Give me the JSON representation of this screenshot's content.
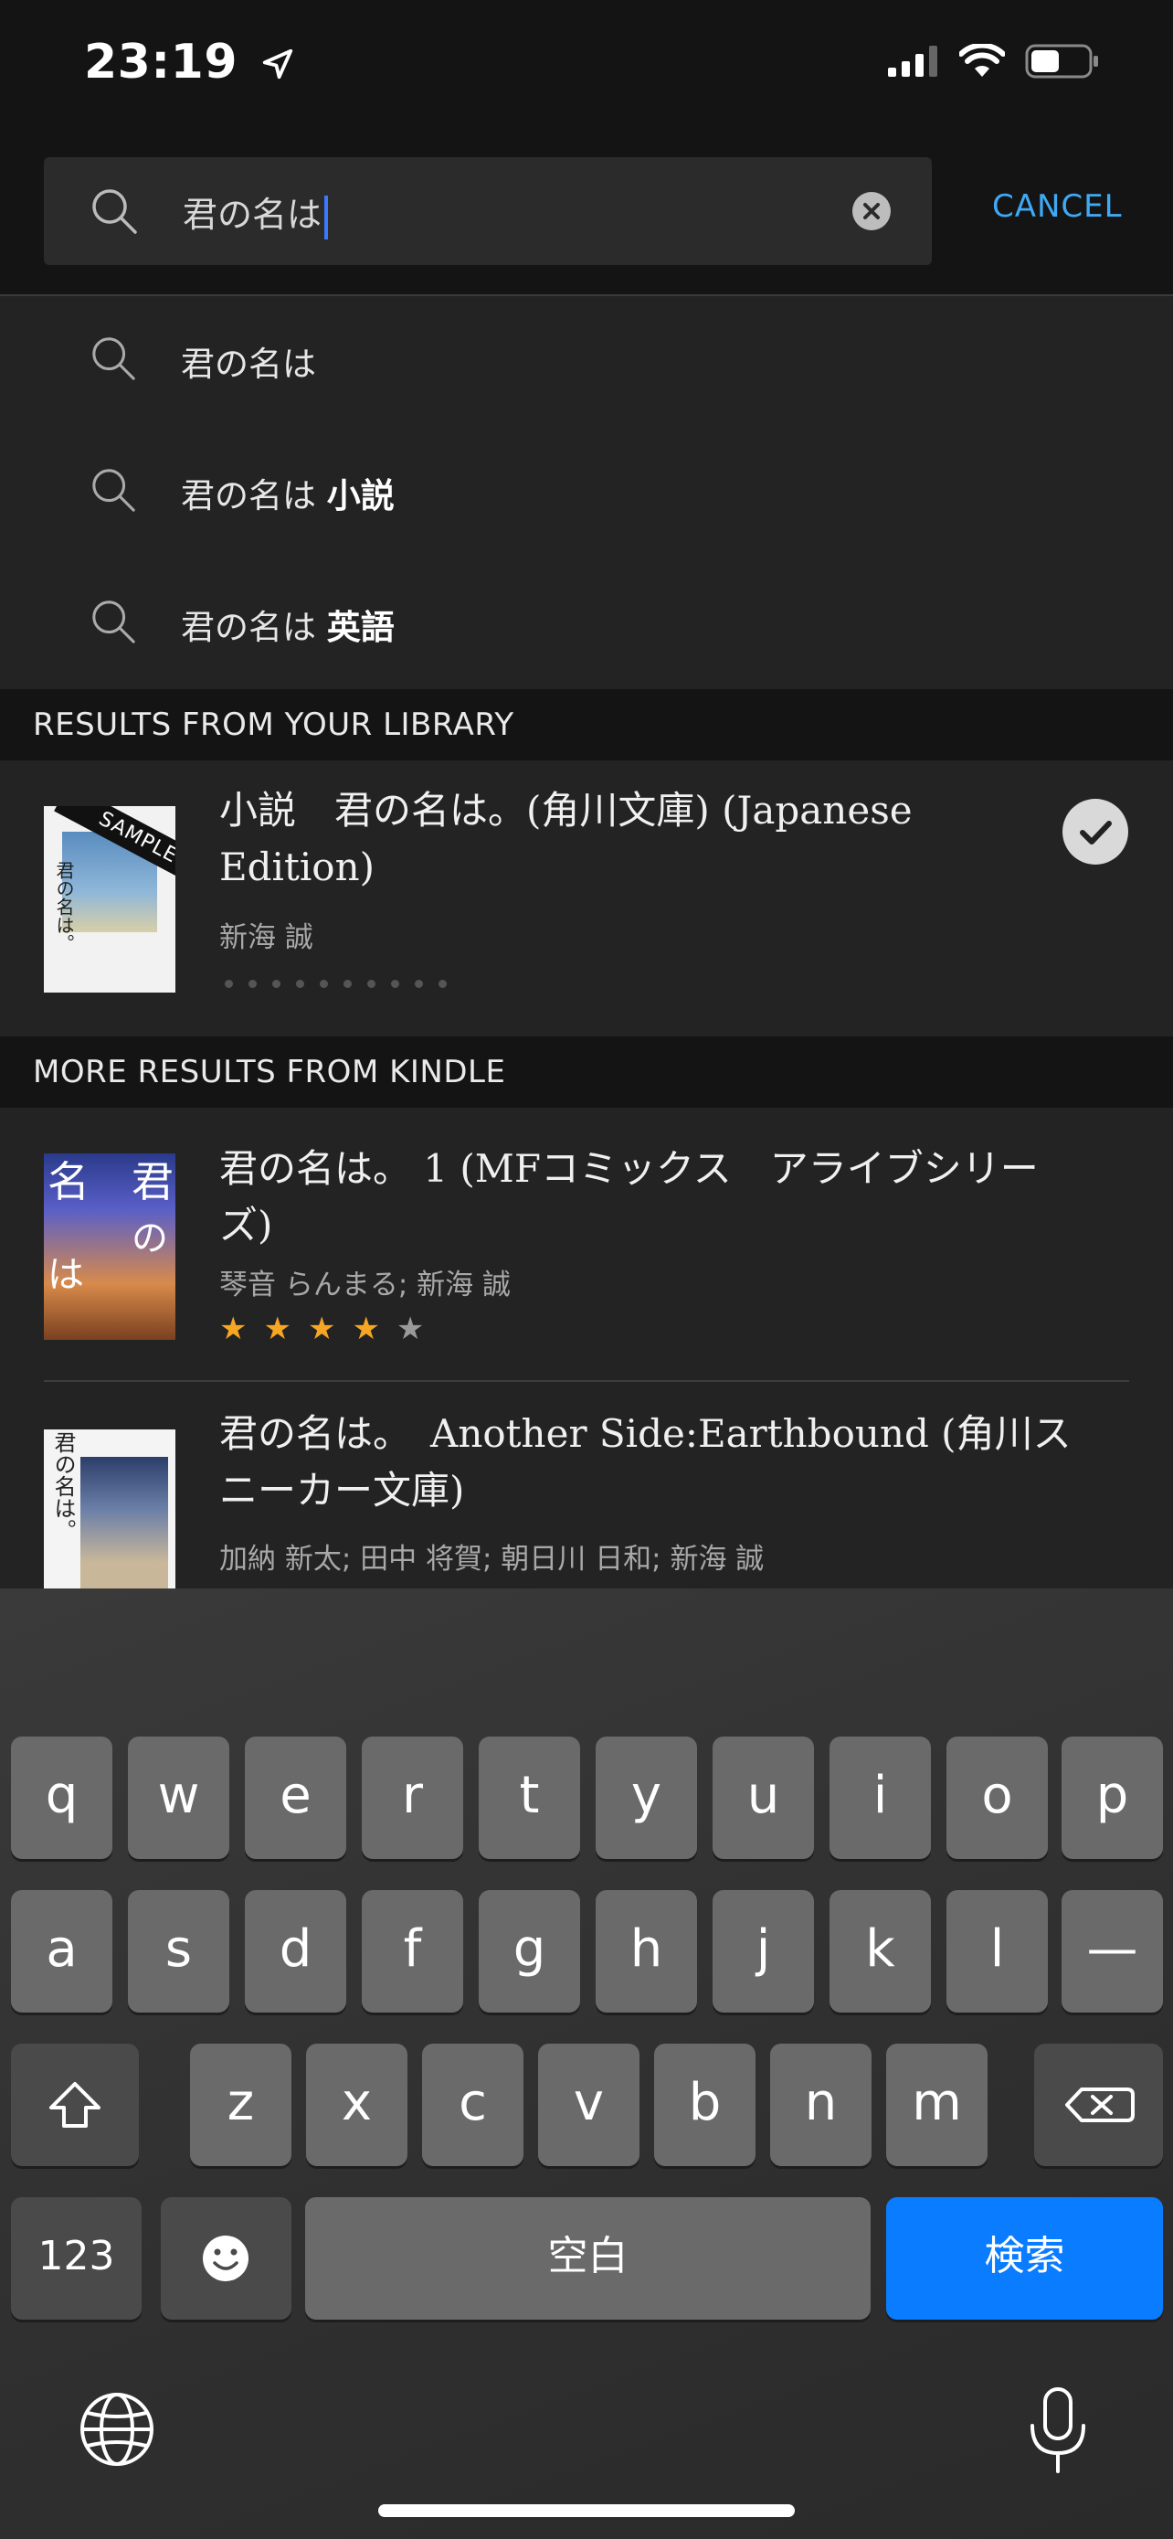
{
  "status_bar": {
    "time": "23:19"
  },
  "search": {
    "query": "君の名は",
    "cancel_label": "CANCEL"
  },
  "suggestions": [
    {
      "base": "君の名は",
      "bold": ""
    },
    {
      "base": "君の名は",
      "bold": "小説"
    },
    {
      "base": "君の名は",
      "bold": "英語"
    }
  ],
  "library_section": {
    "header": "RESULTS FROM YOUR LIBRARY",
    "item": {
      "title_line1": "小説　君の名は。(角川文庫) (Japanese",
      "title_line2": "Edition)",
      "author": "新海 誠",
      "badge": "SAMPLE"
    }
  },
  "kindle_section": {
    "header": "MORE RESULTS FROM KINDLE",
    "items": [
      {
        "title_line1": "君の名は。 1 (MFコミックス　アライブシリー",
        "title_line2": "ズ)",
        "author": "琴音 らんまる; 新海 誠",
        "rating": 4,
        "rating_max": 5
      },
      {
        "title_line1": "君の名は。　Another Side:Earthbound (角川ス",
        "title_line2": "ニーカー文庫)",
        "author": "加納 新太; 田中 将賀; 朝日川 日和; 新海 誠"
      }
    ]
  },
  "keyboard": {
    "row1": [
      "q",
      "w",
      "e",
      "r",
      "t",
      "y",
      "u",
      "i",
      "o",
      "p"
    ],
    "row2": [
      "a",
      "s",
      "d",
      "f",
      "g",
      "h",
      "j",
      "k",
      "l",
      "—"
    ],
    "row3": [
      "z",
      "x",
      "c",
      "v",
      "b",
      "n",
      "m"
    ],
    "num_label": "123",
    "space_label": "空白",
    "search_label": "検索"
  }
}
